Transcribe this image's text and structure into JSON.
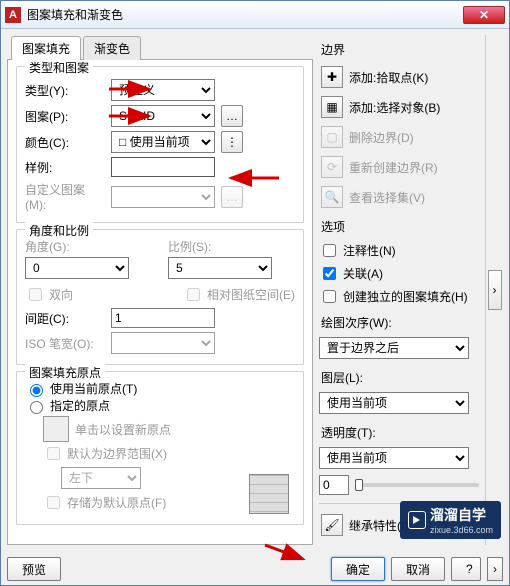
{
  "window": {
    "app_icon": "A",
    "title": "图案填充和渐变色",
    "close_glyph": "✕"
  },
  "tabs": {
    "hatch": "图案填充",
    "gradient": "渐变色"
  },
  "type_pattern": {
    "group_title": "类型和图案",
    "type_label": "类型(Y):",
    "type_value": "预定义",
    "pattern_label": "图案(P):",
    "pattern_value": "SOLID",
    "browse_glyph": "…",
    "color_label": "颜色(C):",
    "color_value": "□ 使用当前项",
    "sample_label": "样例:",
    "custom_label": "自定义图案(M):"
  },
  "angle_scale": {
    "group_title": "角度和比例",
    "angle_label": "角度(G):",
    "angle_value": "0",
    "scale_label": "比例(S):",
    "scale_value": "5",
    "double_label": "双向",
    "relpaper_label": "相对图纸空间(E)",
    "spacing_label": "间距(C):",
    "spacing_value": "1",
    "iso_label": "ISO 笔宽(O):"
  },
  "origin": {
    "group_title": "图案填充原点",
    "use_current_label": "使用当前原点(T)",
    "specified_label": "指定的原点",
    "click_set_label": "单击以设置新原点",
    "default_boundary_label": "默认为边界范围(X)",
    "corner_value": "左下",
    "store_default_label": "存储为默认原点(F)"
  },
  "right": {
    "boundary_title": "边界",
    "add_pick": "添加:拾取点(K)",
    "add_select": "添加:选择对象(B)",
    "remove_boundary": "删除边界(D)",
    "recreate_boundary": "重新创建边界(R)",
    "view_selection": "查看选择集(V)",
    "options_title": "选项",
    "annotative_label": "注释性(N)",
    "associative_label": "关联(A)",
    "separate_label": "创建独立的图案填充(H)",
    "draw_order_label": "绘图次序(W):",
    "draw_order_value": "置于边界之后",
    "layer_label": "图层(L):",
    "layer_value": "使用当前项",
    "transparency_label": "透明度(T):",
    "transparency_value": "使用当前项",
    "transparency_num": "0",
    "inherit_label": "继承特性(I)",
    "chev_glyph": "›"
  },
  "footer": {
    "preview": "预览",
    "ok": "确定",
    "cancel": "取消",
    "help_glyph": "?",
    "expand_glyph": "›"
  },
  "brand": {
    "name": "溜溜自学",
    "url": "zixue.3d66.com"
  },
  "icons": {
    "swatch_dots": "⋮",
    "pickpoint": "✚",
    "selectobj": "▦",
    "delete": "▢",
    "recreate": "⟳",
    "view": "🔍",
    "inherit": "🖌"
  }
}
